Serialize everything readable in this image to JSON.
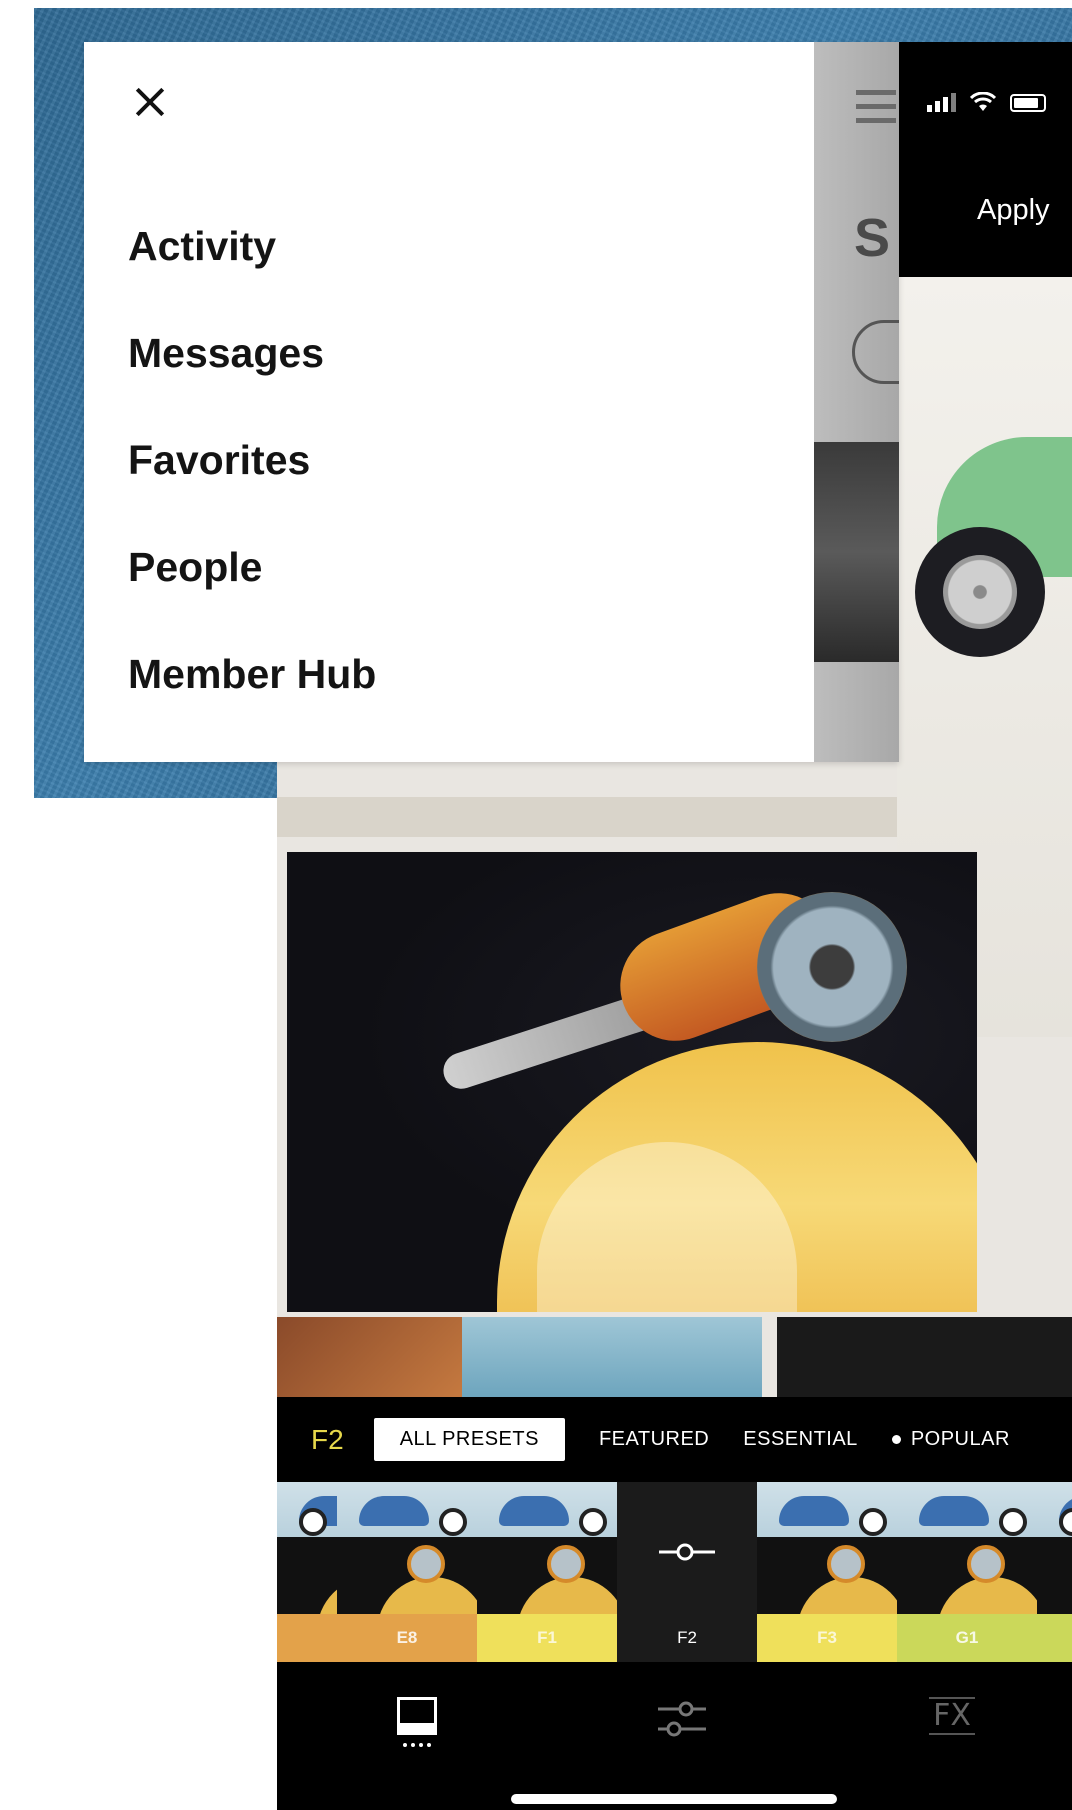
{
  "menu": {
    "close_icon": "close-icon",
    "items": [
      {
        "label": "Activity"
      },
      {
        "label": "Messages"
      },
      {
        "label": "Favorites"
      },
      {
        "label": "People"
      },
      {
        "label": "Member Hub"
      }
    ]
  },
  "underlying_app": {
    "partial_heading": "S"
  },
  "editor": {
    "apply_label": "Apply",
    "current_preset": "F2",
    "tabs": [
      {
        "label": "ALL PRESETS",
        "active": true
      },
      {
        "label": "FEATURED",
        "active": false
      },
      {
        "label": "ESSENTIAL",
        "active": false
      },
      {
        "label": "POPULAR",
        "active": false,
        "dot": true
      }
    ],
    "thumbnails": [
      {
        "label": "",
        "color": "#e3a24a"
      },
      {
        "label": "E8",
        "color": "#e3a24a"
      },
      {
        "label": "F1",
        "color": "#efe05b"
      },
      {
        "label": "F2",
        "selected": true
      },
      {
        "label": "F3",
        "color": "#efe05b"
      },
      {
        "label": "G1",
        "color": "#cbd85a"
      },
      {
        "label": "",
        "color": "#cbd85a"
      }
    ],
    "toolbar": {
      "presets_icon": "presets-icon",
      "adjust_icon": "sliders-icon",
      "fx_label": "FX"
    }
  },
  "colors": {
    "preset_accent": "#e6d84b",
    "backdrop_blue": "#3c7fae"
  }
}
